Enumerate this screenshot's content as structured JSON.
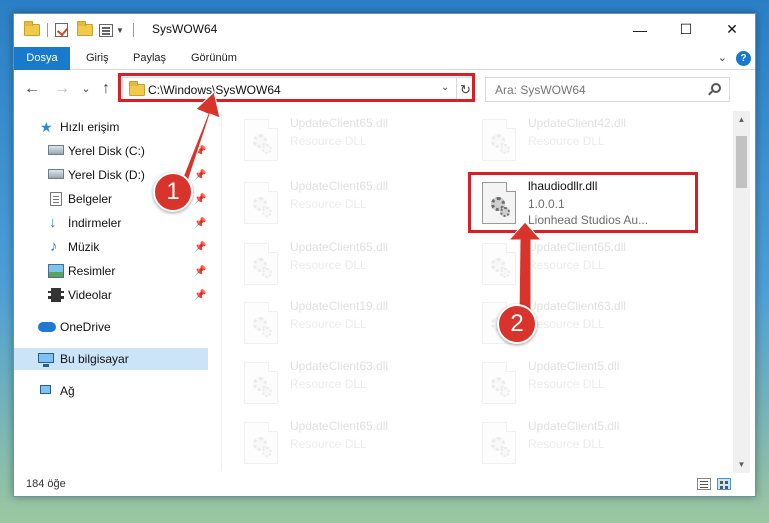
{
  "window": {
    "title": "SysWOW64",
    "controls": {
      "minimize": "—",
      "maximize": "☐",
      "close": "✕"
    }
  },
  "ribbon": {
    "tabs": [
      "Dosya",
      "Giriş",
      "Paylaş",
      "Görünüm"
    ],
    "help": "?"
  },
  "navigation": {
    "back": "←",
    "forward": "→",
    "recent": "⌄",
    "up": "↑",
    "address": "C:\\Windows\\SysWOW64",
    "refresh": "↻",
    "search_placeholder": "Ara: SysWOW64"
  },
  "sidebar": {
    "items": [
      {
        "label": "Hızlı erişim",
        "icon": "star-icon"
      },
      {
        "label": "Yerel Disk (C:)",
        "icon": "drive-icon",
        "pinned": true
      },
      {
        "label": "Yerel Disk (D:)",
        "icon": "drive-icon",
        "pinned": true
      },
      {
        "label": "Belgeler",
        "icon": "documents-icon",
        "pinned": true
      },
      {
        "label": "İndirmeler",
        "icon": "downloads-icon",
        "pinned": true
      },
      {
        "label": "Müzik",
        "icon": "music-icon",
        "pinned": true
      },
      {
        "label": "Resimler",
        "icon": "pictures-icon",
        "pinned": true
      },
      {
        "label": "Videolar",
        "icon": "videos-icon",
        "pinned": true
      },
      {
        "label": "OneDrive",
        "icon": "cloud-icon"
      },
      {
        "label": "Bu bilgisayar",
        "icon": "computer-icon",
        "selected": true
      },
      {
        "label": "Ağ",
        "icon": "network-icon"
      }
    ]
  },
  "files": {
    "left_column": [
      {
        "name": "UpdateClient65.dll",
        "type": "Resource DLL"
      },
      {
        "name": "UpdateClient65.dll",
        "type": "Resource DLL"
      },
      {
        "name": "UpdateClient65.dll",
        "type": "Resource DLL"
      },
      {
        "name": "UpdateClient19.dll",
        "type": "Resource DLL"
      },
      {
        "name": "UpdateClient63.dll",
        "type": "Resource DLL"
      },
      {
        "name": "UpdateClient65.dll",
        "type": "Resource DLL"
      }
    ],
    "right_column": [
      {
        "name": "UpdateClient42.dll",
        "type": "Resource DLL"
      },
      {
        "name": "UpdateClient65.dll",
        "type": "Resource DLL"
      },
      {
        "name": "UpdateClient63.dll",
        "type": "Resource DLL"
      },
      {
        "name": "UpdateClient5.dll",
        "type": "Resource DLL"
      },
      {
        "name": "UpdateClient5.dll",
        "type": "Resource DLL"
      }
    ],
    "highlighted": {
      "name": "lhaudiodllr.dll",
      "version": "1.0.0.1",
      "company": "Lionhead Studios Au..."
    }
  },
  "status": {
    "count": "184 öğe"
  },
  "annotations": {
    "step1": "1",
    "step2": "2"
  },
  "colors": {
    "accent": "#1979ca",
    "highlight_border": "#d81f26",
    "selected_nav": "#cce4f7"
  }
}
